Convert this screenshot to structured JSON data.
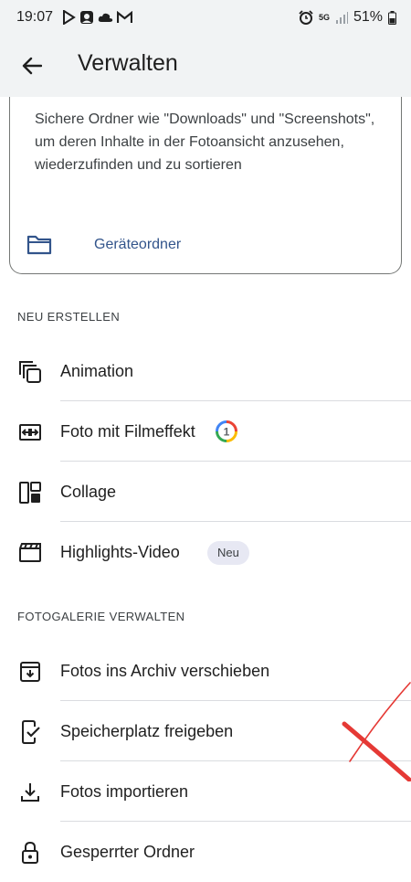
{
  "status_bar": {
    "time": "19:07",
    "network": "5G",
    "battery": "51%",
    "left_icons": [
      "play-icon",
      "image-icon",
      "cloud-icon",
      "gmail-icon"
    ],
    "right_icons": [
      "alarm-icon",
      "signal-icon",
      "battery-icon"
    ]
  },
  "app_bar": {
    "title": "Verwalten",
    "back_icon": "arrow-back-icon"
  },
  "folder_card": {
    "description": "Sichere Ordner wie \"Downloads\" und \"Screenshots\", um deren Inhalte in der Fotoansicht anzusehen, wiederzufinden und zu sortieren",
    "action_label": "Geräteordner",
    "action_icon": "folder-icon",
    "accent_color": "#32548b"
  },
  "sections": [
    {
      "header": "NEU ERSTELLEN",
      "items": [
        {
          "label": "Animation",
          "icon": "animation-icon"
        },
        {
          "label": "Foto mit Filmeffekt",
          "icon": "cinematic-icon",
          "badge": "1"
        },
        {
          "label": "Collage",
          "icon": "collage-icon"
        },
        {
          "label": "Highlights-Video",
          "icon": "clapperboard-icon",
          "badge": "Neu"
        }
      ]
    },
    {
      "header": "FOTOGALERIE VERWALTEN",
      "items": [
        {
          "label": "Fotos ins Archiv verschieben",
          "icon": "archive-icon"
        },
        {
          "label": "Speicherplatz freigeben",
          "icon": "phone-check-icon"
        },
        {
          "label": "Fotos importieren",
          "icon": "download-icon"
        },
        {
          "label": "Gesperrter Ordner",
          "icon": "lock-icon"
        }
      ]
    }
  ],
  "colors": {
    "header_bg": "#f1f3f4",
    "text": "#1f1f1f",
    "divider": "#dadce0",
    "badge_bg": "#e7e8f3",
    "annotation_red": "#e53935"
  }
}
